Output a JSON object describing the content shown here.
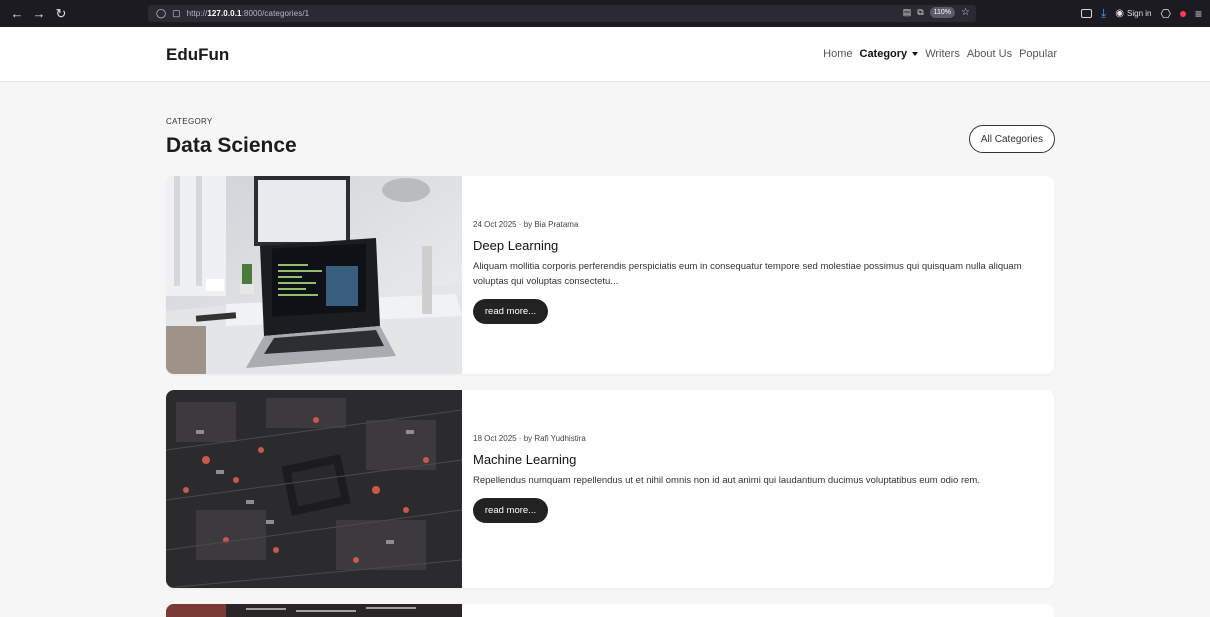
{
  "browser": {
    "url_prefix": "http://",
    "url_host": "127.0.0.1",
    "url_path": ":8000/categories/1",
    "zoom": "110%",
    "signin_label": "Sign in"
  },
  "header": {
    "brand": "EduFun",
    "nav": {
      "home": "Home",
      "category": "Category",
      "writers": "Writers",
      "about": "About Us",
      "popular": "Popular"
    }
  },
  "page": {
    "eyebrow": "CATEGORY",
    "title": "Data Science",
    "all_categories_label": "All Categories"
  },
  "posts": [
    {
      "meta": "24 Oct 2025 · by Bia Pratama",
      "title": "Deep Learning",
      "excerpt": "Aliquam mollitia corporis perferendis perspiciatis eum in consequatur tempore sed molestiae possimus qui quisquam nulla aliquam voluptas qui voluptas consectetu...",
      "read_more": "read more..."
    },
    {
      "meta": "18 Oct 2025 · by Rafi Yudhistira",
      "title": "Machine Learning",
      "excerpt": "Repellendus numquam repellendus ut et nihil omnis non id aut animi qui laudantium ducimus voluptatibus eum odio rem.",
      "read_more": "read more..."
    }
  ],
  "colors": {
    "page_bg": "#f6f6f7",
    "button_dark": "#222222",
    "browser_chrome": "#1c1b22"
  }
}
